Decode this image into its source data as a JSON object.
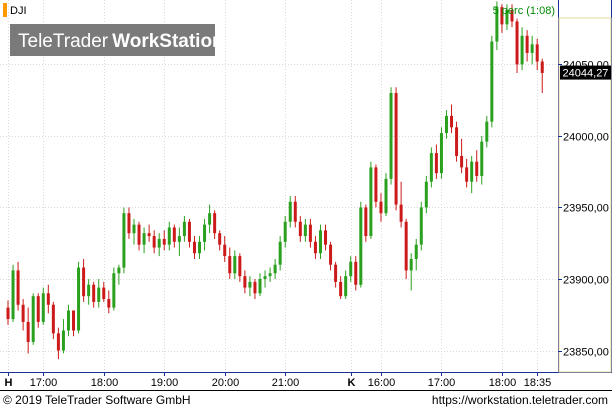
{
  "symbol": "DJI",
  "interval_label": "5 perc (1:08)",
  "watermark": {
    "brand": "TeleTrader",
    "product": "WorkStation"
  },
  "footer": {
    "copyright": "© 2019 TeleTrader Software GmbH",
    "url": "https://workstation.teletrader.com"
  },
  "colors": {
    "up": "#2aa01e",
    "down": "#cc1a1a",
    "grid": "#d9d9d9",
    "axis": "#1a2f99",
    "symbol_box": "#ff9900",
    "interval_text": "#008800",
    "price_tag_bg": "#000000",
    "price_tag_text": "#ffffff"
  },
  "chart_data": {
    "type": "candlestick",
    "symbol": "DJI",
    "interval": "5 perc (1:08)",
    "last_price": 24044.27,
    "last_price_label": "24044,27",
    "ylim": [
      23835,
      24095
    ],
    "y_ticks": [
      {
        "value": 23850,
        "label": "23850,00"
      },
      {
        "value": 23900,
        "label": "23900,00"
      },
      {
        "value": 23950,
        "label": "23950,00"
      },
      {
        "value": 24000,
        "label": "24000,00"
      },
      {
        "value": 24050,
        "label": "24050,00"
      }
    ],
    "x_ticks": [
      {
        "index": 0,
        "label": "H",
        "day_marker": true
      },
      {
        "index": 7,
        "label": "17:00"
      },
      {
        "index": 19,
        "label": "18:00"
      },
      {
        "index": 31,
        "label": "19:00"
      },
      {
        "index": 43,
        "label": "20:00"
      },
      {
        "index": 55,
        "label": "21:00"
      },
      {
        "index": 68,
        "label": "K",
        "day_marker": true
      },
      {
        "index": 74,
        "label": "16:00"
      },
      {
        "index": 86,
        "label": "17:00"
      },
      {
        "index": 98,
        "label": "18:00"
      },
      {
        "index": 105,
        "label": "18:35"
      }
    ],
    "candles": [
      [
        23880,
        23885,
        23868,
        23872
      ],
      [
        23872,
        23910,
        23870,
        23906
      ],
      [
        23906,
        23912,
        23878,
        23882
      ],
      [
        23882,
        23886,
        23864,
        23870
      ],
      [
        23870,
        23880,
        23848,
        23856
      ],
      [
        23856,
        23890,
        23854,
        23888
      ],
      [
        23888,
        23890,
        23866,
        23870
      ],
      [
        23870,
        23894,
        23868,
        23890
      ],
      [
        23890,
        23896,
        23876,
        23882
      ],
      [
        23882,
        23884,
        23858,
        23862
      ],
      [
        23862,
        23866,
        23844,
        23850
      ],
      [
        23850,
        23872,
        23848,
        23864
      ],
      [
        23864,
        23882,
        23860,
        23878
      ],
      [
        23878,
        23878,
        23860,
        23864
      ],
      [
        23864,
        23912,
        23862,
        23908
      ],
      [
        23908,
        23914,
        23884,
        23888
      ],
      [
        23888,
        23900,
        23882,
        23896
      ],
      [
        23896,
        23898,
        23880,
        23884
      ],
      [
        23884,
        23900,
        23880,
        23894
      ],
      [
        23894,
        23898,
        23884,
        23886
      ],
      [
        23886,
        23892,
        23876,
        23880
      ],
      [
        23880,
        23908,
        23878,
        23904
      ],
      [
        23904,
        23910,
        23896,
        23908
      ],
      [
        23908,
        23950,
        23904,
        23946
      ],
      [
        23946,
        23950,
        23928,
        23932
      ],
      [
        23932,
        23942,
        23924,
        23938
      ],
      [
        23938,
        23940,
        23920,
        23924
      ],
      [
        23924,
        23936,
        23918,
        23932
      ],
      [
        23932,
        23938,
        23926,
        23930
      ],
      [
        23930,
        23934,
        23918,
        23922
      ],
      [
        23922,
        23932,
        23916,
        23928
      ],
      [
        23928,
        23934,
        23920,
        23924
      ],
      [
        23924,
        23940,
        23920,
        23936
      ],
      [
        23936,
        23938,
        23922,
        23926
      ],
      [
        23926,
        23936,
        23916,
        23930
      ],
      [
        23930,
        23944,
        23926,
        23940
      ],
      [
        23940,
        23942,
        23922,
        23926
      ],
      [
        23926,
        23930,
        23914,
        23918
      ],
      [
        23918,
        23930,
        23914,
        23926
      ],
      [
        23926,
        23942,
        23920,
        23938
      ],
      [
        23938,
        23952,
        23932,
        23946
      ],
      [
        23946,
        23948,
        23928,
        23932
      ],
      [
        23932,
        23934,
        23920,
        23924
      ],
      [
        23924,
        23930,
        23912,
        23916
      ],
      [
        23916,
        23922,
        23900,
        23904
      ],
      [
        23904,
        23920,
        23900,
        23916
      ],
      [
        23916,
        23918,
        23898,
        23902
      ],
      [
        23902,
        23906,
        23890,
        23894
      ],
      [
        23894,
        23902,
        23888,
        23898
      ],
      [
        23898,
        23900,
        23886,
        23890
      ],
      [
        23890,
        23904,
        23888,
        23900
      ],
      [
        23900,
        23906,
        23894,
        23902
      ],
      [
        23902,
        23908,
        23898,
        23904
      ],
      [
        23904,
        23914,
        23900,
        23910
      ],
      [
        23910,
        23930,
        23906,
        23926
      ],
      [
        23926,
        23944,
        23922,
        23940
      ],
      [
        23940,
        23958,
        23936,
        23954
      ],
      [
        23954,
        23958,
        23936,
        23940
      ],
      [
        23940,
        23944,
        23926,
        23930
      ],
      [
        23930,
        23942,
        23926,
        23938
      ],
      [
        23938,
        23942,
        23922,
        23926
      ],
      [
        23926,
        23930,
        23914,
        23918
      ],
      [
        23918,
        23938,
        23914,
        23934
      ],
      [
        23934,
        23938,
        23920,
        23924
      ],
      [
        23924,
        23926,
        23906,
        23910
      ],
      [
        23910,
        23912,
        23894,
        23898
      ],
      [
        23898,
        23902,
        23886,
        23888
      ],
      [
        23888,
        23906,
        23886,
        23902
      ],
      [
        23902,
        23916,
        23898,
        23912
      ],
      [
        23912,
        23916,
        23892,
        23896
      ],
      [
        23896,
        23954,
        23894,
        23950
      ],
      [
        23950,
        23952,
        23926,
        23930
      ],
      [
        23930,
        23982,
        23928,
        23978
      ],
      [
        23978,
        23980,
        23950,
        23954
      ],
      [
        23954,
        23960,
        23940,
        23946
      ],
      [
        23946,
        23974,
        23944,
        23970
      ],
      [
        23970,
        24034,
        23966,
        24030
      ],
      [
        24030,
        24034,
        23948,
        23952
      ],
      [
        23952,
        23968,
        23936,
        23940
      ],
      [
        23940,
        23942,
        23900,
        23906
      ],
      [
        23906,
        23918,
        23892,
        23914
      ],
      [
        23914,
        23928,
        23906,
        23924
      ],
      [
        23924,
        23954,
        23920,
        23950
      ],
      [
        23950,
        23972,
        23946,
        23968
      ],
      [
        23968,
        23992,
        23964,
        23988
      ],
      [
        23988,
        23994,
        23970,
        23974
      ],
      [
        23974,
        24006,
        23970,
        24002
      ],
      [
        24002,
        24018,
        23998,
        24014
      ],
      [
        24014,
        24022,
        24002,
        24006
      ],
      [
        24006,
        24010,
        23982,
        23986
      ],
      [
        23986,
        23998,
        23974,
        23978
      ],
      [
        23978,
        23984,
        23964,
        23968
      ],
      [
        23968,
        23986,
        23960,
        23982
      ],
      [
        23982,
        23990,
        23968,
        23972
      ],
      [
        23972,
        24000,
        23966,
        23996
      ],
      [
        23996,
        24014,
        23992,
        24010
      ],
      [
        24010,
        24070,
        24006,
        24066
      ],
      [
        24066,
        24094,
        24060,
        24090
      ],
      [
        24090,
        24092,
        24072,
        24078
      ],
      [
        24078,
        24092,
        24074,
        24088
      ],
      [
        24088,
        24092,
        24076,
        24080
      ],
      [
        24080,
        24082,
        24044,
        24050
      ],
      [
        24050,
        24076,
        24046,
        24070
      ],
      [
        24070,
        24074,
        24052,
        24058
      ],
      [
        24058,
        24070,
        24050,
        24064
      ],
      [
        24064,
        24068,
        24046,
        24052
      ],
      [
        24052,
        24054,
        24030,
        24044
      ]
    ]
  }
}
